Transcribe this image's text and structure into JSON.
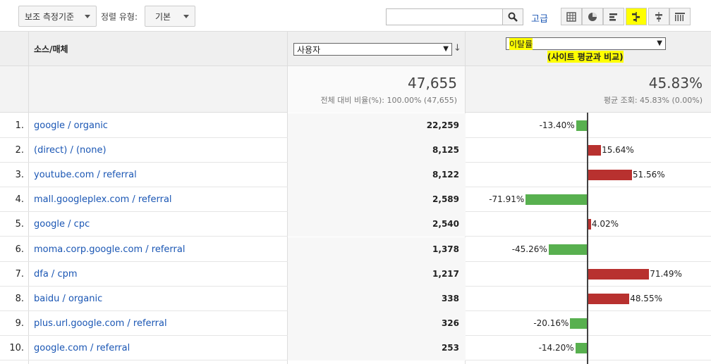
{
  "toolbar": {
    "secondary_dimension": "보조 측정기준",
    "sort_type_label": "정렬 유형:",
    "sort_type_value": "기본",
    "search_placeholder": "",
    "advanced_label": "고급",
    "view_buttons": [
      "table-icon",
      "pie-icon",
      "bar-icon",
      "comparison-icon",
      "term-cloud-icon",
      "pivot-icon"
    ],
    "active_view": "comparison-icon"
  },
  "table": {
    "dimension_header": "소스/매체",
    "users_metric": "사용자",
    "compare_metric": "이탈률",
    "compare_subtitle": "(사이트 평균과 비교)",
    "summary_users_value": "47,655",
    "summary_users_sub": "전체 대비 비율(%): 100.00% (47,655)",
    "summary_compare_value": "45.83%",
    "summary_compare_sub": "평균 조회: 45.83% (0.00%)",
    "rows": [
      {
        "idx": "1.",
        "source": "google / organic",
        "users": "22,259",
        "pct": "-13.40%",
        "delta": -13.4
      },
      {
        "idx": "2.",
        "source": "(direct) / (none)",
        "users": "8,125",
        "pct": "15.64%",
        "delta": 15.64
      },
      {
        "idx": "3.",
        "source": "youtube.com / referral",
        "users": "8,122",
        "pct": "51.56%",
        "delta": 51.56
      },
      {
        "idx": "4.",
        "source": "mall.googleplex.com / referral",
        "users": "2,589",
        "pct": "-71.91%",
        "delta": -71.91
      },
      {
        "idx": "5.",
        "source": "google / cpc",
        "users": "2,540",
        "pct": "4.02%",
        "delta": 4.02
      },
      {
        "idx": "6.",
        "source": "moma.corp.google.com / referral",
        "users": "1,378",
        "pct": "-45.26%",
        "delta": -45.26
      },
      {
        "idx": "7.",
        "source": "dfa / cpm",
        "users": "1,217",
        "pct": "71.49%",
        "delta": 71.49
      },
      {
        "idx": "8.",
        "source": "baidu / organic",
        "users": "338",
        "pct": "48.55%",
        "delta": 48.55
      },
      {
        "idx": "9.",
        "source": "plus.url.google.com / referral",
        "users": "326",
        "pct": "-20.16%",
        "delta": -20.16
      },
      {
        "idx": "10.",
        "source": "google.com / referral",
        "users": "253",
        "pct": "-14.20%",
        "delta": -14.2
      }
    ]
  },
  "colors": {
    "negative_bar": "#58b04f",
    "positive_bar": "#b8312f",
    "link": "#1a56b4",
    "highlight": "#ffff00"
  }
}
